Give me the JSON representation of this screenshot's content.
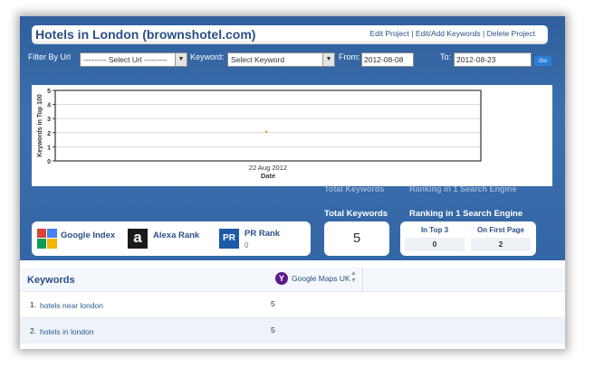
{
  "project": {
    "title": "Hotels in London (brownshotel.com)",
    "actions": [
      "Edit Project",
      "Edit/Add Keywords",
      "Delete Project"
    ],
    "separator": " | "
  },
  "filters": {
    "filter_label": "Filter By Url",
    "url_select": "--------- Select Url ---------",
    "keyword_label": "Keyword:",
    "keyword_select": "Select Keyword",
    "from_label": "From:",
    "from_value": "2012-08-08",
    "to_label": "To:",
    "to_value": "2012-08-23",
    "go_label": "Go"
  },
  "chart_data": {
    "type": "scatter",
    "x": [
      "22 Aug 2012"
    ],
    "y": [
      2
    ],
    "xlabel": "Date",
    "ylabel": "Keywords in Top 100",
    "yticks": [
      0,
      1,
      2,
      3,
      4,
      5
    ],
    "ylim": [
      0,
      5
    ],
    "grid": true,
    "marker_color": "#e8962a"
  },
  "ghost_labels": {
    "total_keywords": "Total Keywords",
    "ranking": "Ranking in 1 Search Engine"
  },
  "indexes": [
    {
      "label": "Google Index",
      "icon": "google-icon"
    },
    {
      "label": "Alexa Rank",
      "icon": "alexa-icon",
      "glyph": "a"
    },
    {
      "label": "PR Rank",
      "icon": "pr-icon",
      "glyph": "PR",
      "value": "0"
    }
  ],
  "totals": {
    "total_label": "Total Keywords",
    "total_value": "5",
    "ranking_label": "Ranking in 1 Search Engine",
    "top3_label": "In Top 3",
    "top3_value": "0",
    "first_page_label": "On First Page",
    "first_page_value": "2"
  },
  "keywords": {
    "header": "Keywords",
    "engine_column": "Google Maps UK",
    "engine_icon": "yahoo-icon",
    "engine_glyph": "Y",
    "rows": [
      {
        "num": "1.",
        "keyword": "hotels near london",
        "value": "5"
      },
      {
        "num": "2.",
        "keyword": "hotels in london",
        "value": "5"
      }
    ]
  },
  "colors": {
    "brand_blue": "#3466a5",
    "title_text": "#2b4f87",
    "link": "#2b5a94"
  }
}
